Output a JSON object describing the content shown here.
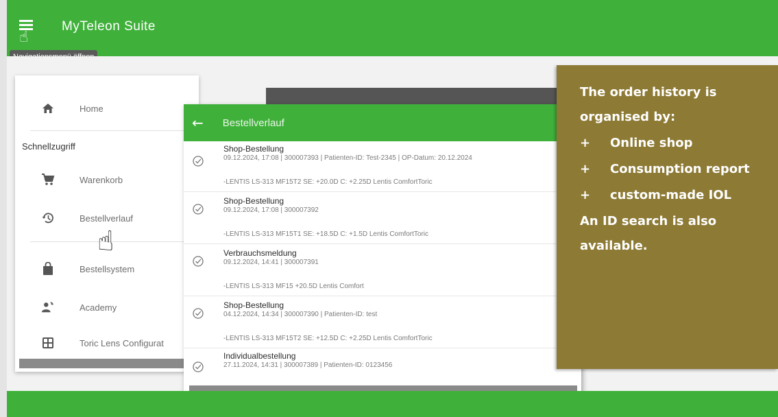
{
  "app": {
    "title": "MyTeleon Suite",
    "menu_tooltip": "Navigationsmenü öffnen"
  },
  "sidebar": {
    "home_label": "Home",
    "section_title": "Schnellzugriff",
    "items": [
      {
        "label": "Warenkorb",
        "icon": "cart-icon"
      },
      {
        "label": "Bestellverlauf",
        "icon": "history-icon"
      },
      {
        "label": "Bestellsystem",
        "icon": "shopping-bag-icon"
      },
      {
        "label": "Academy",
        "icon": "academy-icon"
      },
      {
        "label": "Toric Lens Configurat",
        "icon": "calculator-icon"
      }
    ]
  },
  "order_panel": {
    "title": "Bestellverlauf",
    "entries": [
      {
        "title": "Shop-Bestellung",
        "meta": "09.12.2024, 17:08 | 300007393 | Patienten-ID:  Test-2345 | OP-Datum: 20.12.2024",
        "product": "-LENTIS LS-313 MF15T2 SE: +20.0D C: +2.25D Lentis ComfortToric"
      },
      {
        "title": "Shop-Bestellung",
        "meta": "09.12.2024, 17:08 | 300007392",
        "product": "-LENTIS LS-313 MF15T1 SE: +18.5D C: +1.5D Lentis ComfortToric"
      },
      {
        "title": "Verbrauchsmeldung",
        "meta": "09.12.2024, 14:41 | 300007391",
        "product": "-LENTIS LS-313 MF15 +20.5D Lentis Comfort"
      },
      {
        "title": "Shop-Bestellung",
        "meta": "04.12.2024, 14:34 | 300007390 | Patienten-ID:  test",
        "product": "-LENTIS LS-313 MF15T2 SE: +12.5D C: +2.25D Lentis ComfortToric"
      },
      {
        "title": "Individualbestellung",
        "meta": "27.11.2024, 14:31 | 300007389 | Patienten-ID:  0123456",
        "product": ""
      }
    ]
  },
  "callout": {
    "heading_line1": "The order history is",
    "heading_line2": "organised by:",
    "bullet_symbol": "+",
    "items": [
      "Online shop",
      "Consumption report",
      "custom-made IOL"
    ],
    "note_line1": "An ID search is also",
    "note_line2": "available."
  },
  "colors": {
    "brand_green": "#3fb13a",
    "callout_brown": "#8d7a35"
  }
}
